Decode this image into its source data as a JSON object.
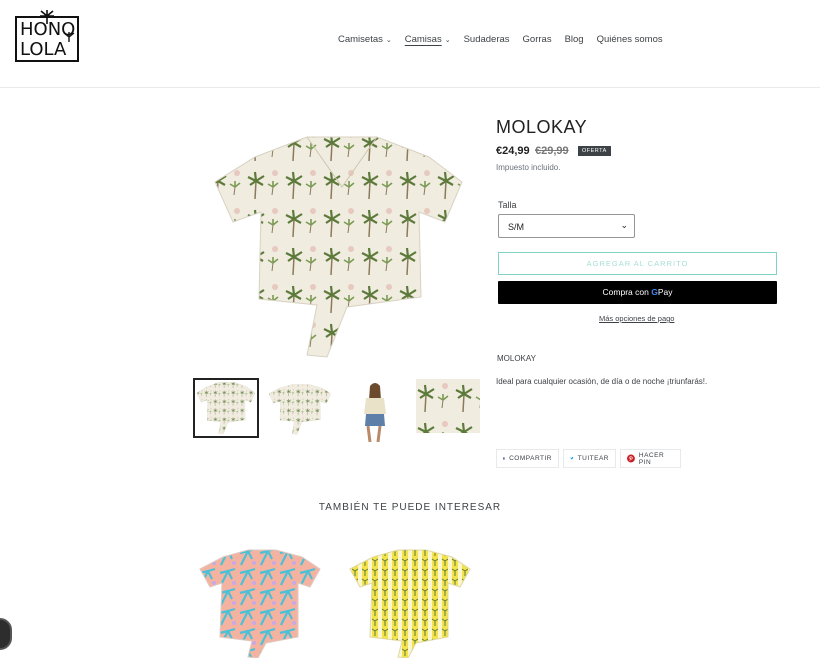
{
  "brand": {
    "line1": "HONO",
    "line2": "LOLA"
  },
  "nav": {
    "items": [
      {
        "label": "Camisetas",
        "dropdown": true
      },
      {
        "label": "Camisas",
        "dropdown": true,
        "active": true
      },
      {
        "label": "Sudaderas",
        "dropdown": false
      },
      {
        "label": "Gorras",
        "dropdown": false
      },
      {
        "label": "Blog",
        "dropdown": false
      },
      {
        "label": "Quiénes somos",
        "dropdown": false
      }
    ],
    "chevron": "⌄"
  },
  "product": {
    "title": "MOLOKAY",
    "price": "€24,99",
    "compare_price": "€29,99",
    "badge": "OFERTA",
    "tax_note": "Impuesto incluido.",
    "size_label": "Talla",
    "size_value": "S/M",
    "add_to_cart": "AGREGAR AL CARRITO",
    "gpay_prefix": "Compra con",
    "gpay_brand": "Pay",
    "more_options": "Más opciones de pago",
    "description_title": "MOLOKAY",
    "description": "Ideal para cualquier ocasión, de día o de noche ¡triunfarás!."
  },
  "share": {
    "facebook": "COMPARTIR",
    "twitter": "TUITEAR",
    "pinterest": "HACER PIN"
  },
  "related": {
    "title": "TAMBIÉN TE PUEDE INTERESAR"
  },
  "colors": {
    "accent": "#7fd3c4",
    "dark": "#3d4246",
    "facebook": "#3b5998",
    "twitter": "#1da1f2",
    "pinterest": "#cb2027"
  }
}
